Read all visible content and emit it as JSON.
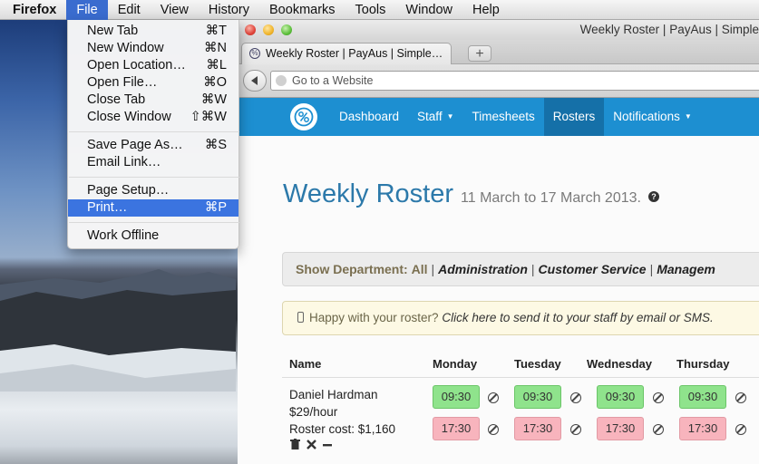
{
  "menubar": {
    "items": [
      "Firefox",
      "File",
      "Edit",
      "View",
      "History",
      "Bookmarks",
      "Tools",
      "Window",
      "Help"
    ]
  },
  "file_menu": {
    "groups": [
      [
        {
          "label": "New Tab",
          "shortcut": "⌘T"
        },
        {
          "label": "New Window",
          "shortcut": "⌘N"
        },
        {
          "label": "Open Location…",
          "shortcut": "⌘L"
        },
        {
          "label": "Open File…",
          "shortcut": "⌘O"
        },
        {
          "label": "Close Tab",
          "shortcut": "⌘W"
        },
        {
          "label": "Close Window",
          "shortcut": "⇧⌘W"
        }
      ],
      [
        {
          "label": "Save Page As…",
          "shortcut": "⌘S"
        },
        {
          "label": "Email Link…",
          "shortcut": ""
        }
      ],
      [
        {
          "label": "Page Setup…",
          "shortcut": ""
        },
        {
          "label": "Print…",
          "shortcut": "⌘P",
          "highlighted": true
        }
      ],
      [
        {
          "label": "Work Offline",
          "shortcut": ""
        }
      ]
    ]
  },
  "browser": {
    "window_title": "Weekly Roster | PayAus | Simple",
    "tab_title": "Weekly Roster | PayAus | Simple…",
    "new_tab_label": "+",
    "url_placeholder": "Go to a Website"
  },
  "site": {
    "nav": {
      "items": [
        {
          "label": "Dashboard",
          "dropdown": false
        },
        {
          "label": "Staff",
          "dropdown": true
        },
        {
          "label": "Timesheets",
          "dropdown": false
        },
        {
          "label": "Rosters",
          "dropdown": false,
          "active": true
        },
        {
          "label": "Notifications",
          "dropdown": true
        }
      ]
    },
    "heading": {
      "title": "Weekly Roster",
      "subtitle": "11 March to 17 March 2013.",
      "help_glyph": "?"
    },
    "department_filter": {
      "label": "Show Department:",
      "options": [
        "All",
        "Administration",
        "Customer Service",
        "Managem"
      ]
    },
    "notice": {
      "text": "Happy with your roster?",
      "link": "Click here to send it to your staff by email or SMS."
    },
    "table": {
      "columns": [
        "Name",
        "Monday",
        "Tuesday",
        "Wednesday",
        "Thursday"
      ],
      "rows": [
        {
          "name": "Daniel Hardman",
          "rate": "$29/hour",
          "cost": "Roster cost: $1,160",
          "shifts": [
            {
              "start": "09:30",
              "end": "17:30"
            },
            {
              "start": "09:30",
              "end": "17:30"
            },
            {
              "start": "09:30",
              "end": "17:30"
            },
            {
              "start": "09:30",
              "end": "17:30"
            }
          ]
        }
      ]
    }
  }
}
